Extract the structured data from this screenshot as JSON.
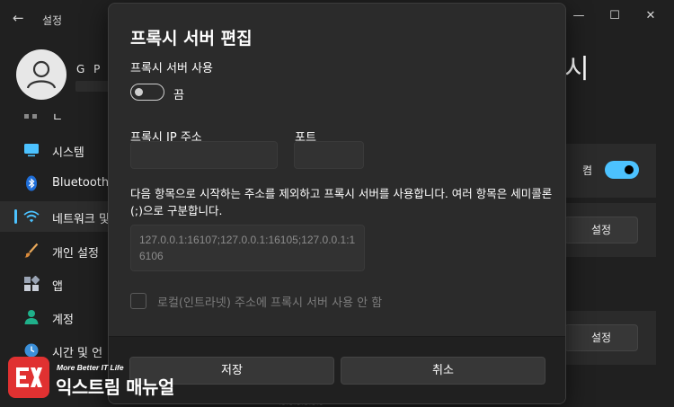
{
  "window": {
    "back_glyph": "←",
    "title": "설정",
    "controls": {
      "minimize": "—",
      "maximize": "☐",
      "close": "✕"
    }
  },
  "profile": {
    "name": "G P"
  },
  "sidebar": {
    "partial_item": "ㄴ",
    "items": [
      {
        "label": "시스템",
        "icon": "monitor-icon"
      },
      {
        "label": "Bluetooth",
        "icon": "bluetooth-icon"
      },
      {
        "label": "네트워크 및",
        "icon": "wifi-icon",
        "active": true
      },
      {
        "label": "개인 설정",
        "icon": "brush-icon"
      },
      {
        "label": "앱",
        "icon": "apps-icon"
      },
      {
        "label": "계정",
        "icon": "person-icon"
      },
      {
        "label": "시간 및 언",
        "icon": "clock-globe-icon"
      }
    ]
  },
  "background": {
    "header_fragment": "시",
    "toggle_label": "켬",
    "setup_button_1": "설정",
    "setup_button_2": "설정",
    "bottom_fragment": "~~~~~~"
  },
  "dialog": {
    "title": "프록시 서버 편집",
    "use_proxy_label": "프록시 서버 사용",
    "use_proxy_state": "끔",
    "use_proxy_on": false,
    "ip_label": "프록시 IP 주소",
    "ip_value": "",
    "port_label": "포트",
    "port_value": "",
    "exceptions_description": "다음 항목으로 시작하는 주소를 제외하고 프록시 서버를 사용합니다. 여러 항목은 세미콜론(;)으로 구분합니다.",
    "exceptions_value": "127.0.0.1:16107;127.0.0.1:16105;127.0.0.1:16106",
    "local_bypass_label": "로컬(인트라넷) 주소에 프록시 서버 사용 안 함",
    "local_bypass_checked": false,
    "save_button": "저장",
    "cancel_button": "취소"
  },
  "watermark": {
    "tagline": "More Better IT Life",
    "name": "익스트림 매뉴얼"
  },
  "colors": {
    "accent": "#4cc2ff",
    "dialog_bg": "#2b2b2b",
    "window_bg": "#202020",
    "watermark_red": "#e03131"
  }
}
